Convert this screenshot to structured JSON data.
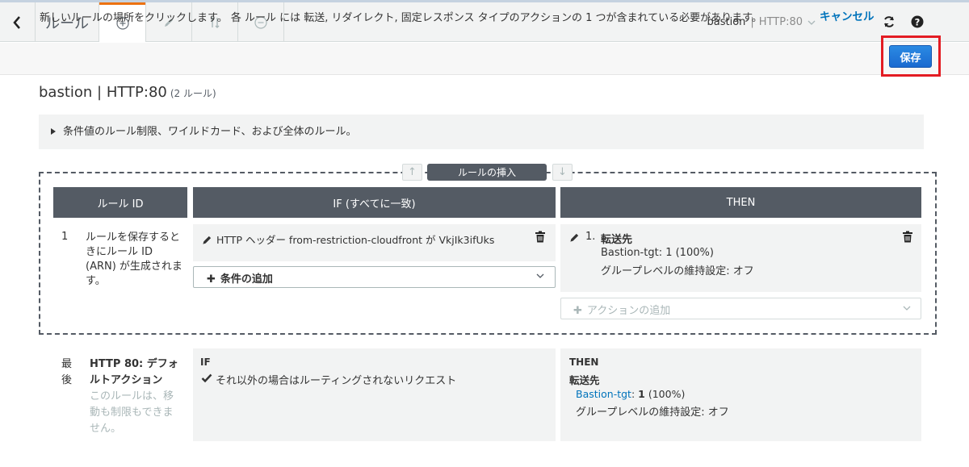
{
  "toolbar": {
    "title": "ルール",
    "lb_name": "bastion",
    "lb_sep": "|",
    "lb_listener": "HTTP:80",
    "accent_color": "#ec7211",
    "icons": [
      "back-chevron-icon",
      "add-circle-icon",
      "pencil-icon",
      "reorder-icon",
      "remove-circle-icon",
      "refresh-icon",
      "help-icon"
    ]
  },
  "instruction": {
    "text": "新しいルールの場所をクリックします。 各 ルール には 転送, リダイレクト, 固定レスポンス タイプのアクションの 1 つが含まれている必要があります。",
    "cancel_label": "キャンセル",
    "save_label": "保存",
    "highlight_color": "#e31c23"
  },
  "heading": {
    "title": "bastion | HTTP:80",
    "count": "(2 ルール)"
  },
  "info": {
    "text": "条件値のルール制限、ワイルドカード、および全体のルール。"
  },
  "insert": {
    "label": "ルールの挿入"
  },
  "table": {
    "headers": {
      "rule_id": "ルール ID",
      "if": "IF (すべてに一致)",
      "then": "THEN"
    }
  },
  "rule1": {
    "number": "1",
    "description": "ルールを保存するときにルール ID (ARN) が生成されます。",
    "condition": "HTTP ヘッダー from-restriction-cloudfront が VkjIk3ifUks",
    "add_condition_label": "条件の追加",
    "action_number": "1.",
    "action_title": "転送先",
    "action_target": "Bastion-tgt: 1 (100%)",
    "action_stickiness": "グループレベルの維持設定: オフ",
    "add_action_label": "アクションの追加"
  },
  "default_rule": {
    "last_label": "最後",
    "name": "HTTP 80: デフォルトアクション",
    "description": "このルールは、移動も制限もできません。",
    "if_label": "IF",
    "if_condition": "それ以外の場合はルーティングされないリクエスト",
    "then_label": "THEN",
    "then_title": "転送先",
    "target_link": "Bastion-tgt",
    "target_sep": ":",
    "target_weight": "1",
    "target_pct": "(100%)",
    "stickiness": "グループレベルの維持設定: オフ"
  }
}
